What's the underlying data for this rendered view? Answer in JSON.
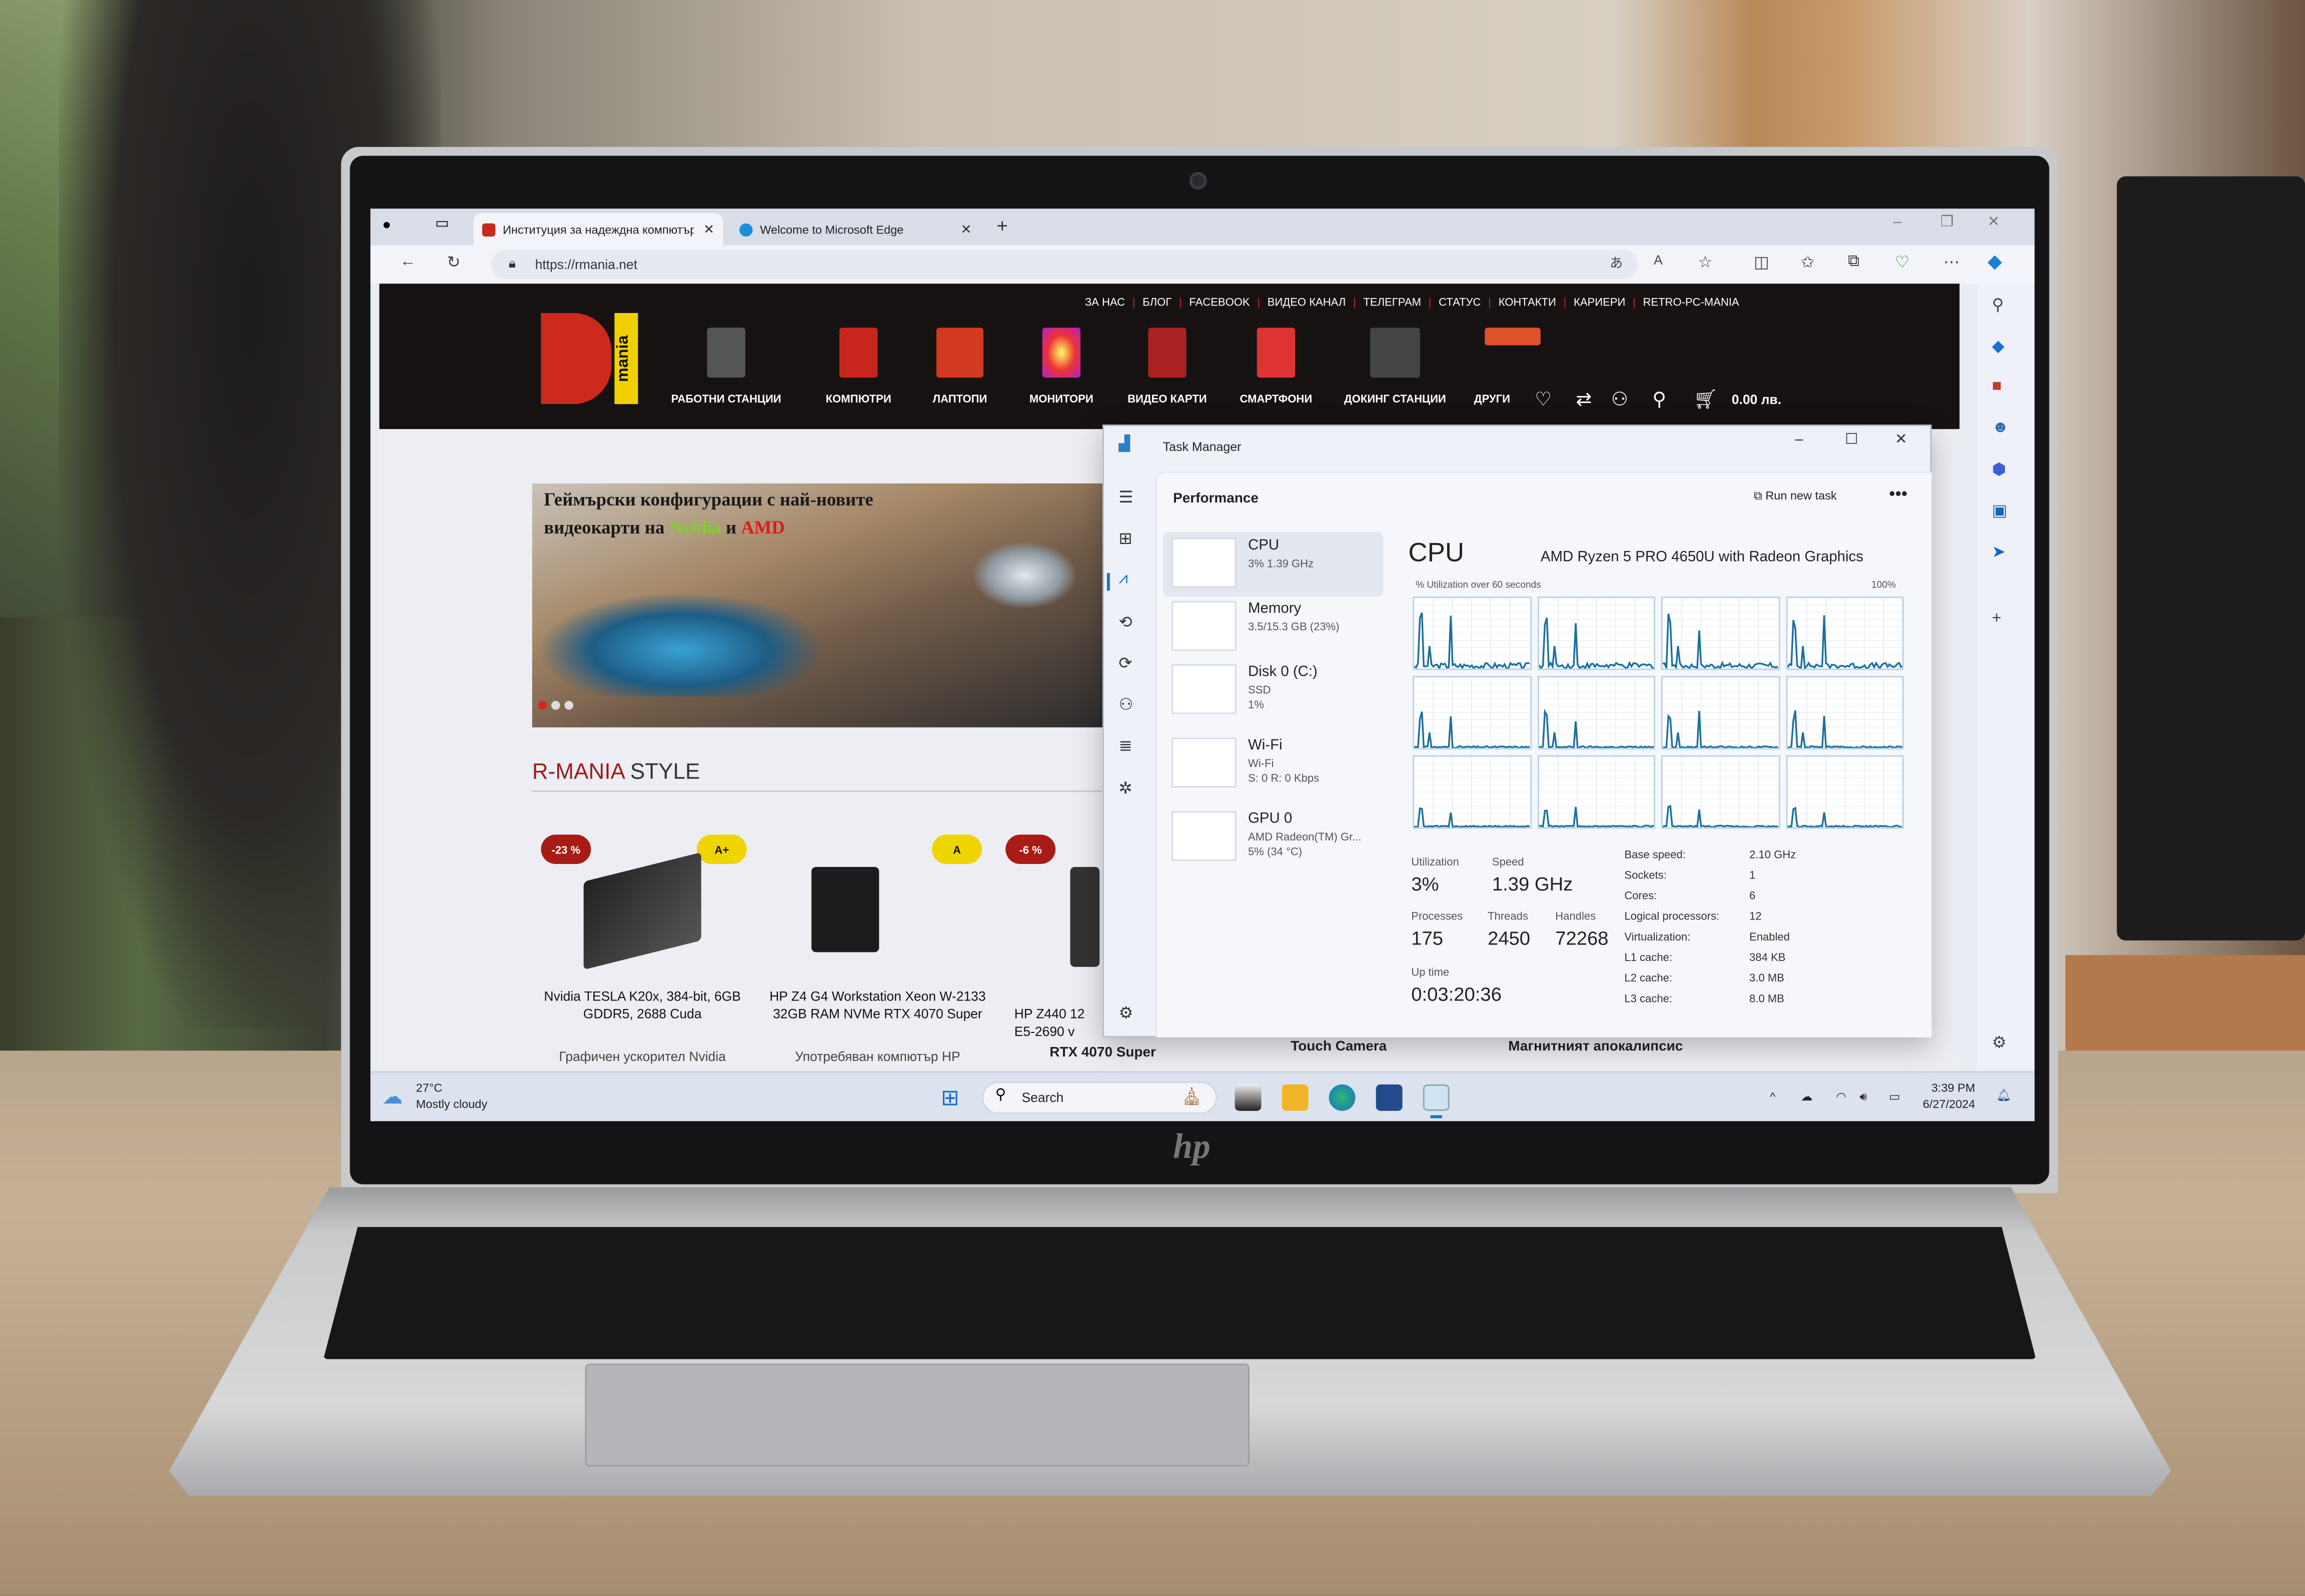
{
  "browser": {
    "tabs": [
      {
        "label": "Институция за надеждна компютърна техника",
        "favicon_color": "#c62a1c",
        "active": true
      },
      {
        "label": "Welcome to Microsoft Edge",
        "favicon_color": "#1a8fd6",
        "active": false
      }
    ],
    "new_tab": "+",
    "url": "https://rmania.net"
  },
  "site": {
    "top_links": [
      "ЗА НАС",
      "БЛОГ",
      "FACEBOOK",
      "ВИДЕО КАНАЛ",
      "ТЕЛЕГРАМ",
      "СТАТУС",
      "КОНТАКТИ",
      "КАРИЕРИ",
      "RETRO-PC-MANIA"
    ],
    "logo_text": "mania",
    "categories": [
      "РАБОТНИ СТАНЦИИ",
      "КОМПЮТРИ",
      "ЛАПТОПИ",
      "МОНИТОРИ",
      "ВИДЕО КАРТИ",
      "СМАРТФОНИ",
      "ДОКИНГ СТАНЦИИ",
      "ДРУГИ"
    ],
    "cart_total": "0.00 лв.",
    "hero": {
      "line1": "Геймърски конфигурации с най-новите",
      "line2_prefix": "видеокарти на ",
      "brand1": "Nvidia",
      "joiner": " и ",
      "brand2": "AMD",
      "brand1_color": "#7ed321",
      "brand2_color": "#e01b1b"
    },
    "section_title_accent": "R-MANIA",
    "section_title_rest": " STYLE",
    "products": [
      {
        "discount": "-23 %",
        "rating": "A+",
        "name": "Nvidia TESLA K20x, 384-bit, 6GB GDDR5, 2688 Cuda",
        "desc": "Графичен ускорител Nvidia"
      },
      {
        "discount": "-6 %",
        "rating": "A",
        "name": "HP Z4 G4 Workstation Xeon W-2133 32GB RAM NVMe RTX 4070 Super",
        "desc": "Употребяван компютър HP"
      },
      {
        "name": "HP Z440 12 E5-2690 v",
        "desc": ""
      }
    ],
    "row2": [
      "RTX 4070 Super",
      "Touch Camera",
      "Магнитният апокалипсис"
    ]
  },
  "task_manager": {
    "title": "Task Manager",
    "page": "Performance",
    "run_new_task": "Run new task",
    "more": "•••",
    "resources": [
      {
        "name": "CPU",
        "sub": "3% 1.39 GHz"
      },
      {
        "name": "Memory",
        "sub": "3.5/15.3 GB (23%)"
      },
      {
        "name": "Disk 0 (C:)",
        "sub": "SSD\n1%"
      },
      {
        "name": "Wi-Fi",
        "sub": "Wi-Fi\nS: 0 R: 0 Kbps"
      },
      {
        "name": "GPU 0",
        "sub": "AMD Radeon(TM) Gr...\n5% (34 °C)"
      }
    ],
    "cpu": {
      "heading": "CPU",
      "model": "AMD Ryzen 5 PRO 4650U with Radeon Graphics",
      "graph_label": "% Utilization over 60 seconds",
      "graph_max": "100%",
      "graph_color": "#1f6f9f",
      "utilization_label": "Utilization",
      "utilization": "3%",
      "speed_label": "Speed",
      "speed": "1.39 GHz",
      "processes_label": "Processes",
      "processes": "175",
      "threads_label": "Threads",
      "threads": "2450",
      "handles_label": "Handles",
      "handles": "72268",
      "uptime_label": "Up time",
      "uptime": "0:03:20:36",
      "specs": [
        {
          "k": "Base speed:",
          "v": "2.10 GHz"
        },
        {
          "k": "Sockets:",
          "v": "1"
        },
        {
          "k": "Cores:",
          "v": "6"
        },
        {
          "k": "Logical processors:",
          "v": "12"
        },
        {
          "k": "Virtualization:",
          "v": "Enabled"
        },
        {
          "k": "L1 cache:",
          "v": "384 KB"
        },
        {
          "k": "L2 cache:",
          "v": "3.0 MB"
        },
        {
          "k": "L3 cache:",
          "v": "8.0 MB"
        }
      ]
    }
  },
  "taskbar": {
    "weather_temp": "27°C",
    "weather_desc": "Mostly cloudy",
    "search_placeholder": "Search",
    "time": "3:39 PM",
    "date": "6/27/2024"
  }
}
